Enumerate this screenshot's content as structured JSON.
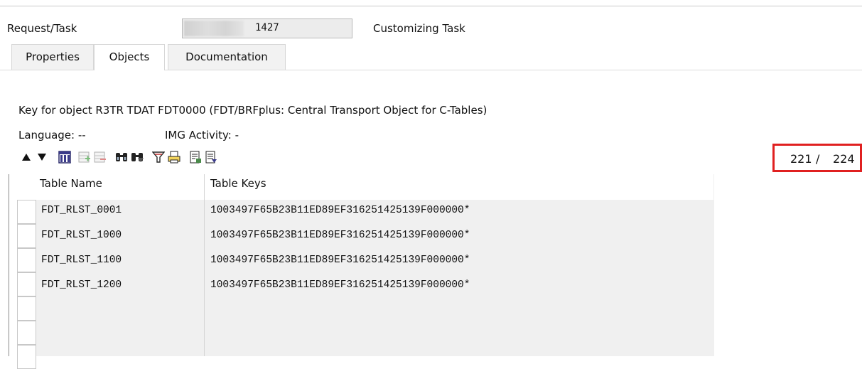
{
  "header": {
    "request_label": "Request/Task",
    "request_number": "1427",
    "request_type": "Customizing Task"
  },
  "tabs": [
    {
      "label": "Properties",
      "active": false
    },
    {
      "label": "Objects",
      "active": true
    },
    {
      "label": "Documentation",
      "active": false
    }
  ],
  "object_info": {
    "key_text": "Key for object R3TR TDAT FDT0000 (FDT/BRFplus: Central Transport Object for C-Tables)",
    "language": "Language: --",
    "img_activity": "IMG Activity: -"
  },
  "toolbar": {
    "icons": [
      "triangle-up-icon",
      "triangle-down-icon",
      "columns-icon",
      "insert-row-icon",
      "delete-row-icon",
      "find-icon",
      "find-next-icon",
      "filter-icon",
      "print-icon",
      "export-icon",
      "details-icon"
    ],
    "counter_current": "221",
    "counter_separator": "/",
    "counter_total": "224",
    "highlight_color": "#e02020"
  },
  "table": {
    "columns": [
      "Table Name",
      "Table Keys"
    ],
    "rows": [
      {
        "name": "FDT_RLST_0001",
        "key": "1003497F65B23B11ED89EF316251425139F000000*"
      },
      {
        "name": "FDT_RLST_1000",
        "key": "1003497F65B23B11ED89EF316251425139F000000*"
      },
      {
        "name": "FDT_RLST_1100",
        "key": "1003497F65B23B11ED89EF316251425139F000000*"
      },
      {
        "name": "FDT_RLST_1200",
        "key": "1003497F65B23B11ED89EF316251425139F000000*"
      }
    ]
  }
}
